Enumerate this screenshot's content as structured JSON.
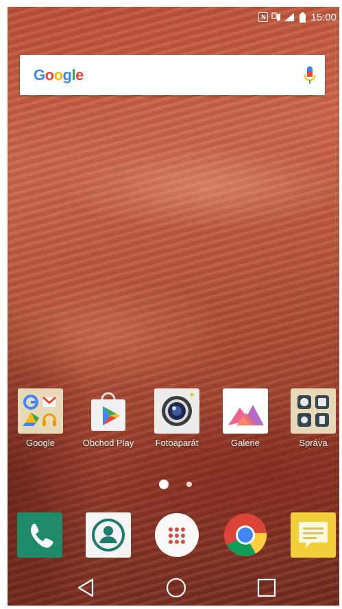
{
  "status_bar": {
    "nfc_icon_label": "N",
    "time": "15:00"
  },
  "search": {
    "logo_text": "Google",
    "icon": "mic-icon"
  },
  "apps": [
    {
      "label": "Google",
      "icon": "google-folder-icon"
    },
    {
      "label": "Obchod Play",
      "icon": "play-store-icon"
    },
    {
      "label": "Fotoaparát",
      "icon": "camera-icon"
    },
    {
      "label": "Galerie",
      "icon": "gallery-icon"
    },
    {
      "label": "Správa",
      "icon": "management-folder-icon"
    }
  ],
  "page_indicator": {
    "pages": 2,
    "current": 1
  },
  "dock": [
    {
      "icon": "phone-icon"
    },
    {
      "icon": "contacts-icon"
    },
    {
      "icon": "app-drawer-icon"
    },
    {
      "icon": "chrome-icon"
    },
    {
      "icon": "messages-icon"
    }
  ],
  "nav": [
    {
      "icon": "back-icon"
    },
    {
      "icon": "home-icon"
    },
    {
      "icon": "recents-icon"
    }
  ],
  "colors": {
    "google_blue": "#4285F4",
    "google_red": "#EA4335",
    "google_yellow": "#FBBC05",
    "google_green": "#34A853",
    "phone_green": "#1e8a6a"
  }
}
